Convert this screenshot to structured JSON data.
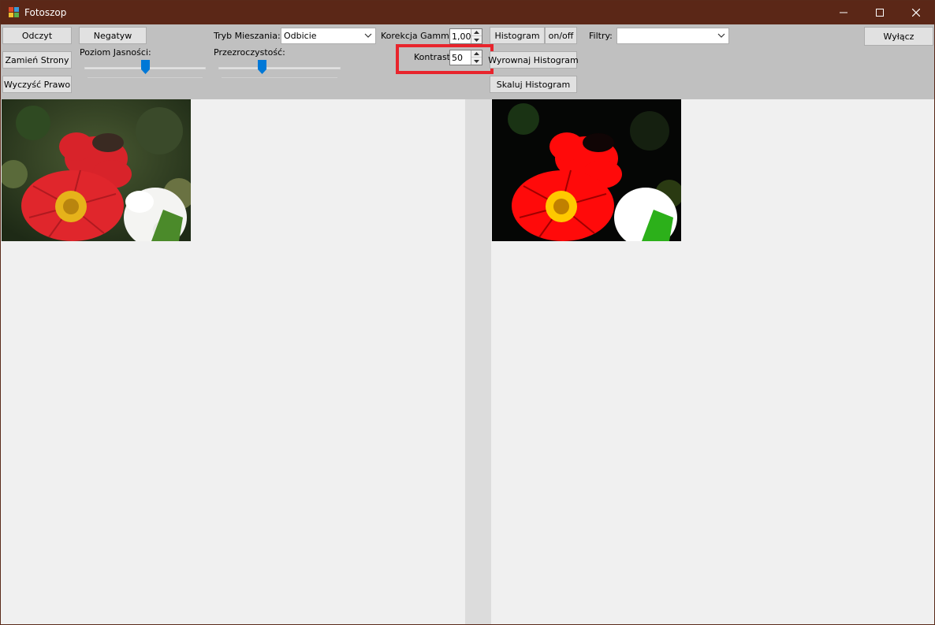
{
  "window": {
    "title": "Fotoszop"
  },
  "toolbar": {
    "read_label": "Odczyt",
    "negative_label": "Negatyw",
    "swap_label": "Zamień Strony",
    "clear_right_label": "Wyczyść Prawo",
    "brightness_label": "Poziom Jasności:",
    "brightness_level": 0.5,
    "blend_mode_label": "Tryb Mieszania:",
    "blend_mode_value": "Odbicie",
    "opacity_label": "Przezroczystość:",
    "opacity_level": 0.35,
    "gamma_label": "Korekcja Gamma:",
    "gamma_value": "1,00",
    "contrast_label": "Kontrast:",
    "contrast_value": "50",
    "histogram_label": "Histogram",
    "onoff_label": "on/off",
    "equalize_label": "Wyrownaj Histogram",
    "scale_label": "Skaluj Histogram",
    "filters_label": "Filtry:",
    "filters_value": "",
    "exit_label": "Wyłącz"
  },
  "colors": {
    "titlebar": "#5b2717",
    "toolbar": "#c0c0c0",
    "highlight": "#e8242c",
    "slider_thumb": "#0078d7"
  },
  "icons": [
    "app-icon",
    "minimize-icon",
    "maximize-icon",
    "close-icon",
    "chevron-down-icon",
    "spin-up-icon",
    "spin-down-icon"
  ]
}
